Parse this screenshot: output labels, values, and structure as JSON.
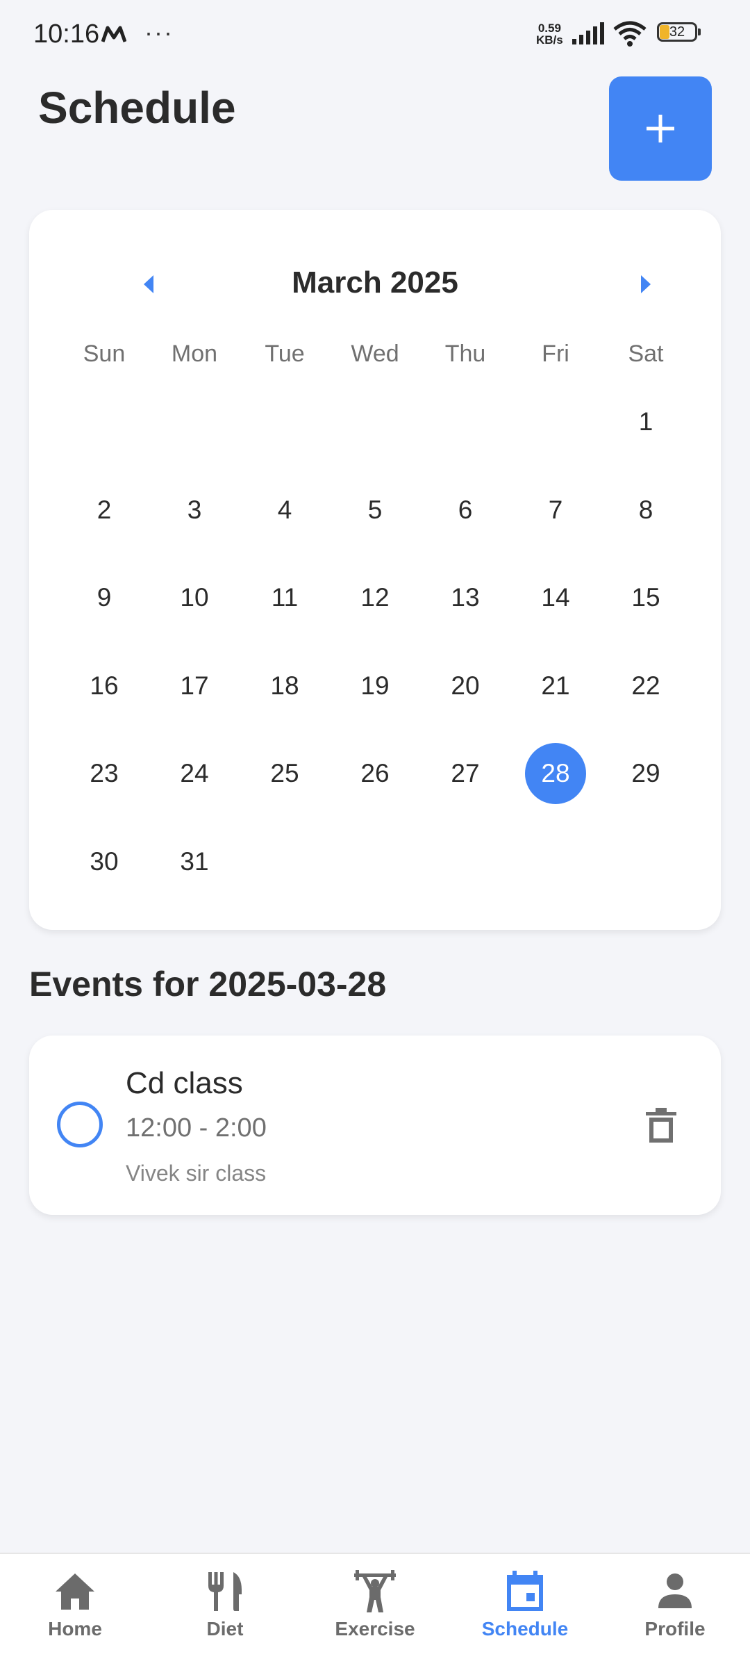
{
  "status_bar": {
    "time": "10:16",
    "speed_value": "0.59",
    "speed_unit": "KB/s",
    "battery": "32",
    "carrier_icon": "m-logo-icon",
    "more_icon": "more-dots-icon"
  },
  "header": {
    "title": "Schedule",
    "add_icon": "plus-icon"
  },
  "calendar": {
    "month_label": "March 2025",
    "weekdays": [
      "Sun",
      "Mon",
      "Tue",
      "Wed",
      "Thu",
      "Fri",
      "Sat"
    ],
    "days": [
      "",
      "",
      "",
      "",
      "",
      "",
      "1",
      "2",
      "3",
      "4",
      "5",
      "6",
      "7",
      "8",
      "9",
      "10",
      "11",
      "12",
      "13",
      "14",
      "15",
      "16",
      "17",
      "18",
      "19",
      "20",
      "21",
      "22",
      "23",
      "24",
      "25",
      "26",
      "27",
      "28",
      "29",
      "30",
      "31",
      "",
      "",
      "",
      "",
      ""
    ],
    "selected_day": "28",
    "accent_color": "#4285f4"
  },
  "events": {
    "title": "Events for 2025-03-28",
    "items": [
      {
        "title": "Cd class",
        "time": "12:00 - 2:00",
        "description": "Vivek sir class",
        "completed": false
      }
    ]
  },
  "bottom_nav": {
    "items": [
      {
        "label": "Home",
        "icon": "home-icon"
      },
      {
        "label": "Diet",
        "icon": "fork-knife-icon"
      },
      {
        "label": "Exercise",
        "icon": "weightlifting-icon"
      },
      {
        "label": "Schedule",
        "icon": "calendar-icon",
        "active": true
      },
      {
        "label": "Profile",
        "icon": "person-icon"
      }
    ]
  }
}
